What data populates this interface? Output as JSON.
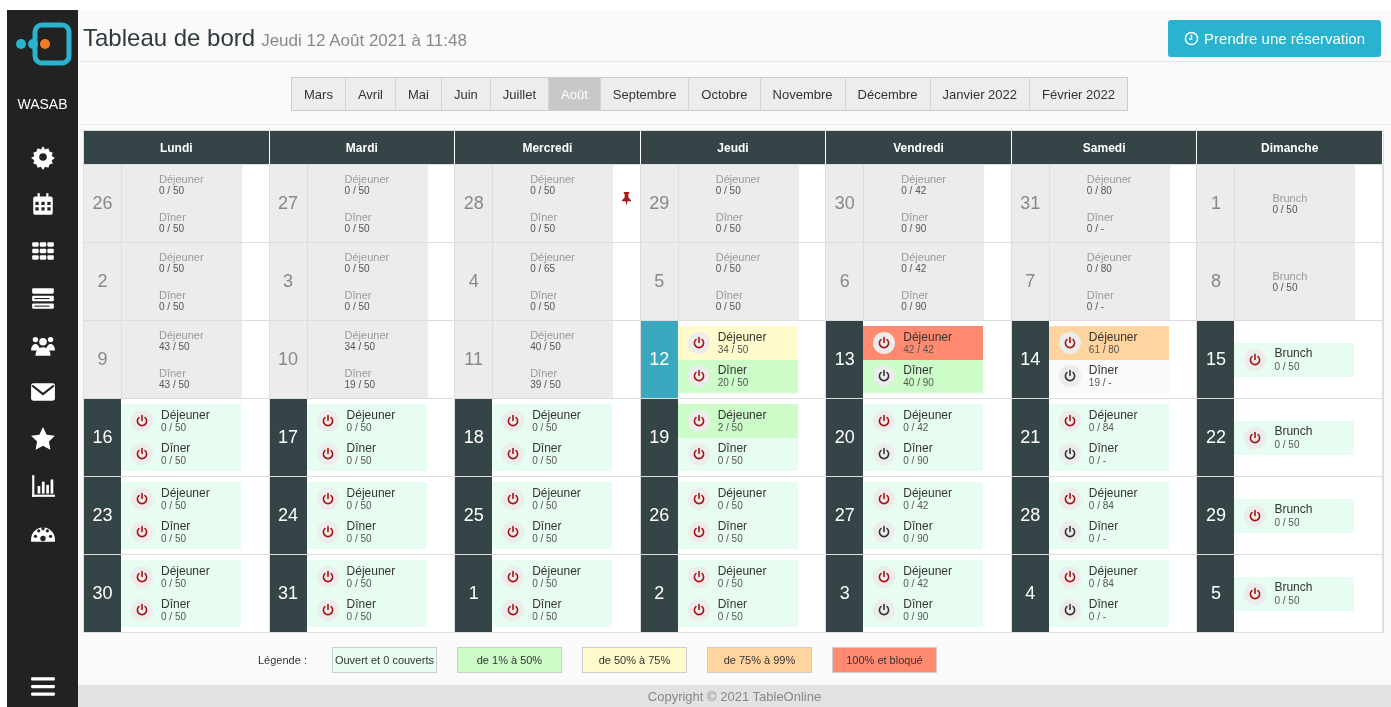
{
  "sidebar": {
    "brand": "WASAB"
  },
  "header": {
    "title": "Tableau de bord",
    "subtitle": "Jeudi 12 Août 2021 à 11:48",
    "button": "Prendre une réservation"
  },
  "months": [
    {
      "label": "Mars",
      "selected": false
    },
    {
      "label": "Avril",
      "selected": false
    },
    {
      "label": "Mai",
      "selected": false
    },
    {
      "label": "Juin",
      "selected": false
    },
    {
      "label": "Juillet",
      "selected": false
    },
    {
      "label": "Août",
      "selected": true
    },
    {
      "label": "Septembre",
      "selected": false
    },
    {
      "label": "Octobre",
      "selected": false
    },
    {
      "label": "Novembre",
      "selected": false
    },
    {
      "label": "Décembre",
      "selected": false
    },
    {
      "label": "Janvier 2022",
      "selected": false
    },
    {
      "label": "Février 2022",
      "selected": false
    }
  ],
  "weekdays": [
    "Lundi",
    "Mardi",
    "Mercredi",
    "Jeudi",
    "Vendredi",
    "Samedi",
    "Dimanche"
  ],
  "weeks": [
    [
      {
        "day": "26",
        "kind": "past",
        "services": [
          {
            "name": "Déjeuner",
            "count": "0 / 50",
            "kind": "past"
          },
          {
            "name": "Dîner",
            "count": "0 / 50",
            "kind": "past"
          }
        ]
      },
      {
        "day": "27",
        "kind": "past",
        "services": [
          {
            "name": "Déjeuner",
            "count": "0 / 50",
            "kind": "past"
          },
          {
            "name": "Dîner",
            "count": "0 / 50",
            "kind": "past"
          }
        ]
      },
      {
        "day": "28",
        "kind": "past",
        "pinned": true,
        "services": [
          {
            "name": "Déjeuner",
            "count": "0 / 50",
            "kind": "past"
          },
          {
            "name": "Dîner",
            "count": "0 / 50",
            "kind": "past"
          }
        ]
      },
      {
        "day": "29",
        "kind": "past",
        "services": [
          {
            "name": "Déjeuner",
            "count": "0 / 50",
            "kind": "past"
          },
          {
            "name": "Dîner",
            "count": "0 / 50",
            "kind": "past"
          }
        ]
      },
      {
        "day": "30",
        "kind": "past",
        "services": [
          {
            "name": "Déjeuner",
            "count": "0 / 42",
            "kind": "past"
          },
          {
            "name": "Dîner",
            "count": "0 / 90",
            "kind": "past"
          }
        ]
      },
      {
        "day": "31",
        "kind": "past",
        "services": [
          {
            "name": "Déjeuner",
            "count": "0 / 80",
            "kind": "past"
          },
          {
            "name": "Dîner",
            "count": "0 / -",
            "kind": "past"
          }
        ]
      },
      {
        "day": "1",
        "kind": "past",
        "services": [
          {
            "name": "Brunch",
            "count": "0 / 50",
            "kind": "past"
          }
        ]
      }
    ],
    [
      {
        "day": "2",
        "kind": "past",
        "services": [
          {
            "name": "Déjeuner",
            "count": "0 / 50",
            "kind": "past"
          },
          {
            "name": "Dîner",
            "count": "0 / 50",
            "kind": "past"
          }
        ]
      },
      {
        "day": "3",
        "kind": "past",
        "services": [
          {
            "name": "Déjeuner",
            "count": "0 / 50",
            "kind": "past"
          },
          {
            "name": "Dîner",
            "count": "0 / 50",
            "kind": "past"
          }
        ]
      },
      {
        "day": "4",
        "kind": "past",
        "services": [
          {
            "name": "Déjeuner",
            "count": "0 / 65",
            "kind": "past"
          },
          {
            "name": "Dîner",
            "count": "0 / 50",
            "kind": "past"
          }
        ]
      },
      {
        "day": "5",
        "kind": "past",
        "services": [
          {
            "name": "Déjeuner",
            "count": "0 / 50",
            "kind": "past"
          },
          {
            "name": "Dîner",
            "count": "0 / 50",
            "kind": "past"
          }
        ]
      },
      {
        "day": "6",
        "kind": "past",
        "services": [
          {
            "name": "Déjeuner",
            "count": "0 / 42",
            "kind": "past"
          },
          {
            "name": "Dîner",
            "count": "0 / 90",
            "kind": "past"
          }
        ]
      },
      {
        "day": "7",
        "kind": "past",
        "services": [
          {
            "name": "Déjeuner",
            "count": "0 / 80",
            "kind": "past"
          },
          {
            "name": "Dîner",
            "count": "0 / -",
            "kind": "past"
          }
        ]
      },
      {
        "day": "8",
        "kind": "past",
        "services": [
          {
            "name": "Brunch",
            "count": "0 / 50",
            "kind": "past"
          }
        ]
      }
    ],
    [
      {
        "day": "9",
        "kind": "past",
        "services": [
          {
            "name": "Déjeuner",
            "count": "43 / 50",
            "kind": "past"
          },
          {
            "name": "Dîner",
            "count": "43 / 50",
            "kind": "past"
          }
        ]
      },
      {
        "day": "10",
        "kind": "past",
        "services": [
          {
            "name": "Déjeuner",
            "count": "34 / 50",
            "kind": "past"
          },
          {
            "name": "Dîner",
            "count": "19 / 50",
            "kind": "past"
          }
        ]
      },
      {
        "day": "11",
        "kind": "past",
        "services": [
          {
            "name": "Déjeuner",
            "count": "40 / 50",
            "kind": "past"
          },
          {
            "name": "Dîner",
            "count": "39 / 50",
            "kind": "past"
          }
        ]
      },
      {
        "day": "12",
        "kind": "today",
        "services": [
          {
            "name": "Déjeuner",
            "count": "34 / 50",
            "kind": "open",
            "color": "#fffbcc",
            "active": true
          },
          {
            "name": "Dîner",
            "count": "20 / 50",
            "kind": "open",
            "color": "#ccfcc8",
            "active": true
          }
        ]
      },
      {
        "day": "13",
        "kind": "future",
        "services": [
          {
            "name": "Déjeuner",
            "count": "42 / 42",
            "kind": "open",
            "color": "#ff8a70",
            "active": true
          },
          {
            "name": "Dîner",
            "count": "40 / 90",
            "kind": "open",
            "color": "#ccfcc8",
            "active": false
          }
        ]
      },
      {
        "day": "14",
        "kind": "future",
        "services": [
          {
            "name": "Déjeuner",
            "count": "61 / 80",
            "kind": "open",
            "color": "#ffd49e",
            "active": true
          },
          {
            "name": "Dîner",
            "count": "19 / -",
            "kind": "open",
            "color": "#fafafa",
            "active": false
          }
        ]
      },
      {
        "day": "15",
        "kind": "future",
        "services": [
          {
            "name": "Brunch",
            "count": "0 / 50",
            "kind": "open",
            "color": "#e8fdf1",
            "active": true
          }
        ]
      }
    ],
    [
      {
        "day": "16",
        "kind": "future",
        "services": [
          {
            "name": "Déjeuner",
            "count": "0 / 50",
            "kind": "open",
            "color": "#e8fdf1",
            "active": true
          },
          {
            "name": "Dîner",
            "count": "0 / 50",
            "kind": "open",
            "color": "#e8fdf1",
            "active": true
          }
        ]
      },
      {
        "day": "17",
        "kind": "future",
        "services": [
          {
            "name": "Déjeuner",
            "count": "0 / 50",
            "kind": "open",
            "color": "#e8fdf1",
            "active": true
          },
          {
            "name": "Dîner",
            "count": "0 / 50",
            "kind": "open",
            "color": "#e8fdf1",
            "active": true
          }
        ]
      },
      {
        "day": "18",
        "kind": "future",
        "services": [
          {
            "name": "Déjeuner",
            "count": "0 / 50",
            "kind": "open",
            "color": "#e8fdf1",
            "active": true
          },
          {
            "name": "Dîner",
            "count": "0 / 50",
            "kind": "open",
            "color": "#e8fdf1",
            "active": true
          }
        ]
      },
      {
        "day": "19",
        "kind": "future",
        "services": [
          {
            "name": "Déjeuner",
            "count": "2 / 50",
            "kind": "open",
            "color": "#ccfcc8",
            "active": true
          },
          {
            "name": "Dîner",
            "count": "0 / 50",
            "kind": "open",
            "color": "#e8fdf1",
            "active": true
          }
        ]
      },
      {
        "day": "20",
        "kind": "future",
        "services": [
          {
            "name": "Déjeuner",
            "count": "0 / 42",
            "kind": "open",
            "color": "#e8fdf1",
            "active": true
          },
          {
            "name": "Dîner",
            "count": "0 / 90",
            "kind": "open",
            "color": "#e8fdf1",
            "active": false
          }
        ]
      },
      {
        "day": "21",
        "kind": "future",
        "services": [
          {
            "name": "Déjeuner",
            "count": "0 / 84",
            "kind": "open",
            "color": "#e8fdf1",
            "active": true
          },
          {
            "name": "Dîner",
            "count": "0 / -",
            "kind": "open",
            "color": "#e8fdf1",
            "active": false
          }
        ]
      },
      {
        "day": "22",
        "kind": "future",
        "services": [
          {
            "name": "Brunch",
            "count": "0 / 50",
            "kind": "open",
            "color": "#e8fdf1",
            "active": true
          }
        ]
      }
    ],
    [
      {
        "day": "23",
        "kind": "future",
        "services": [
          {
            "name": "Déjeuner",
            "count": "0 / 50",
            "kind": "open",
            "color": "#e8fdf1",
            "active": true
          },
          {
            "name": "Dîner",
            "count": "0 / 50",
            "kind": "open",
            "color": "#e8fdf1",
            "active": true
          }
        ]
      },
      {
        "day": "24",
        "kind": "future",
        "services": [
          {
            "name": "Déjeuner",
            "count": "0 / 50",
            "kind": "open",
            "color": "#e8fdf1",
            "active": true
          },
          {
            "name": "Dîner",
            "count": "0 / 50",
            "kind": "open",
            "color": "#e8fdf1",
            "active": true
          }
        ]
      },
      {
        "day": "25",
        "kind": "future",
        "services": [
          {
            "name": "Déjeuner",
            "count": "0 / 50",
            "kind": "open",
            "color": "#e8fdf1",
            "active": true
          },
          {
            "name": "Dîner",
            "count": "0 / 50",
            "kind": "open",
            "color": "#e8fdf1",
            "active": true
          }
        ]
      },
      {
        "day": "26",
        "kind": "future",
        "services": [
          {
            "name": "Déjeuner",
            "count": "0 / 50",
            "kind": "open",
            "color": "#e8fdf1",
            "active": true
          },
          {
            "name": "Dîner",
            "count": "0 / 50",
            "kind": "open",
            "color": "#e8fdf1",
            "active": true
          }
        ]
      },
      {
        "day": "27",
        "kind": "future",
        "services": [
          {
            "name": "Déjeuner",
            "count": "0 / 42",
            "kind": "open",
            "color": "#e8fdf1",
            "active": true
          },
          {
            "name": "Dîner",
            "count": "0 / 90",
            "kind": "open",
            "color": "#e8fdf1",
            "active": false
          }
        ]
      },
      {
        "day": "28",
        "kind": "future",
        "services": [
          {
            "name": "Déjeuner",
            "count": "0 / 84",
            "kind": "open",
            "color": "#e8fdf1",
            "active": true
          },
          {
            "name": "Dîner",
            "count": "0 / -",
            "kind": "open",
            "color": "#e8fdf1",
            "active": false
          }
        ]
      },
      {
        "day": "29",
        "kind": "future",
        "services": [
          {
            "name": "Brunch",
            "count": "0 / 50",
            "kind": "open",
            "color": "#e8fdf1",
            "active": true
          }
        ]
      }
    ],
    [
      {
        "day": "30",
        "kind": "future",
        "services": [
          {
            "name": "Déjeuner",
            "count": "0 / 50",
            "kind": "open",
            "color": "#e8fdf1",
            "active": true
          },
          {
            "name": "Dîner",
            "count": "0 / 50",
            "kind": "open",
            "color": "#e8fdf1",
            "active": true
          }
        ]
      },
      {
        "day": "31",
        "kind": "future",
        "services": [
          {
            "name": "Déjeuner",
            "count": "0 / 50",
            "kind": "open",
            "color": "#e8fdf1",
            "active": true
          },
          {
            "name": "Dîner",
            "count": "0 / 50",
            "kind": "open",
            "color": "#e8fdf1",
            "active": true
          }
        ]
      },
      {
        "day": "1",
        "kind": "future",
        "services": [
          {
            "name": "Déjeuner",
            "count": "0 / 50",
            "kind": "open",
            "color": "#e8fdf1",
            "active": true
          },
          {
            "name": "Dîner",
            "count": "0 / 50",
            "kind": "open",
            "color": "#e8fdf1",
            "active": true
          }
        ]
      },
      {
        "day": "2",
        "kind": "future",
        "services": [
          {
            "name": "Déjeuner",
            "count": "0 / 50",
            "kind": "open",
            "color": "#e8fdf1",
            "active": true
          },
          {
            "name": "Dîner",
            "count": "0 / 50",
            "kind": "open",
            "color": "#e8fdf1",
            "active": true
          }
        ]
      },
      {
        "day": "3",
        "kind": "future",
        "services": [
          {
            "name": "Déjeuner",
            "count": "0 / 42",
            "kind": "open",
            "color": "#e8fdf1",
            "active": true
          },
          {
            "name": "Dîner",
            "count": "0 / 90",
            "kind": "open",
            "color": "#e8fdf1",
            "active": false
          }
        ]
      },
      {
        "day": "4",
        "kind": "future",
        "services": [
          {
            "name": "Déjeuner",
            "count": "0 / 84",
            "kind": "open",
            "color": "#e8fdf1",
            "active": true
          },
          {
            "name": "Dîner",
            "count": "0 / -",
            "kind": "open",
            "color": "#e8fdf1",
            "active": false
          }
        ]
      },
      {
        "day": "5",
        "kind": "future",
        "services": [
          {
            "name": "Brunch",
            "count": "0 / 50",
            "kind": "open",
            "color": "#e8fdf1",
            "active": true
          }
        ]
      }
    ]
  ],
  "legend": {
    "label": "Légende :",
    "items": [
      {
        "label": "Ouvert et 0 couverts",
        "color": "#e8fdf1"
      },
      {
        "label": "de 1% à 50%",
        "color": "#ccfcc8"
      },
      {
        "label": "de 50% à 75%",
        "color": "#fffbcc"
      },
      {
        "label": "de 75% à 99%",
        "color": "#ffd49e"
      },
      {
        "label": "100% et bloqué",
        "color": "#ff8a70"
      }
    ]
  },
  "footer": "Copyright © 2021 TableOnline"
}
